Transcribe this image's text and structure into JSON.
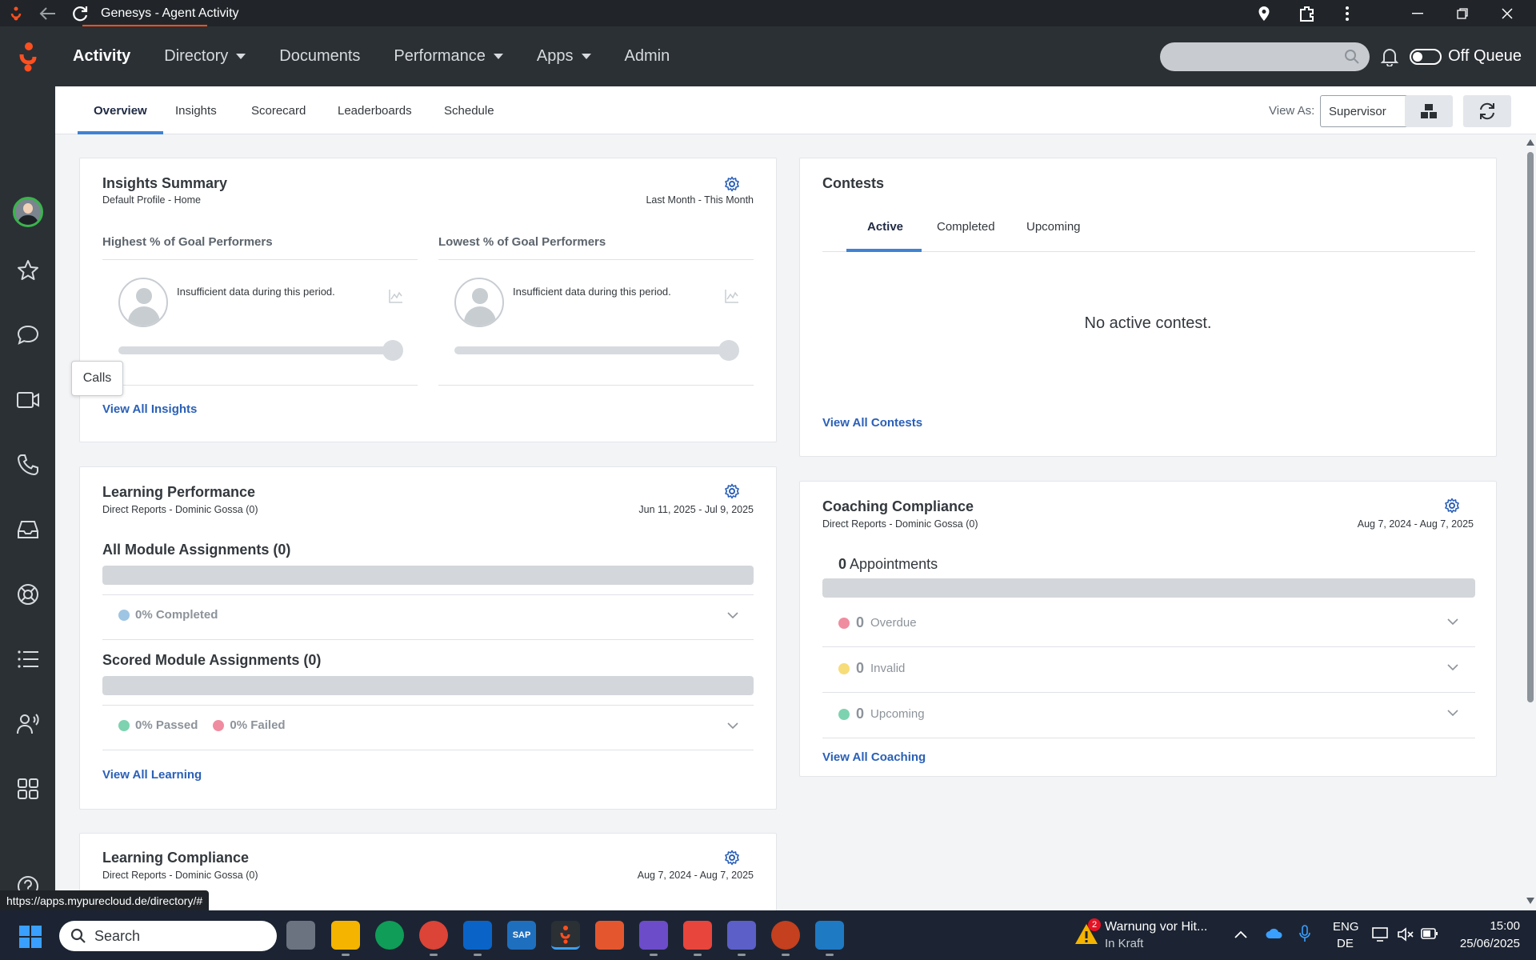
{
  "window": {
    "title": "Genesys - Agent Activity"
  },
  "topnav": {
    "items": [
      "Activity",
      "Directory",
      "Documents",
      "Performance",
      "Apps",
      "Admin"
    ],
    "queue_label": "Off Queue"
  },
  "sidebar": {
    "tooltip": "Calls"
  },
  "subtabs": {
    "items": [
      "Overview",
      "Insights",
      "Scorecard",
      "Leaderboards",
      "Schedule"
    ],
    "view_as_label": "View As:",
    "view_as_value": "Supervisor"
  },
  "insights": {
    "title": "Insights Summary",
    "subtitle": "Default Profile - Home",
    "range": "Last Month - This Month",
    "highest_title": "Highest % of Goal Performers",
    "lowest_title": "Lowest % of Goal Performers",
    "insufficient": "Insufficient data during this period.",
    "link": "View All Insights"
  },
  "learning_performance": {
    "title": "Learning Performance",
    "subtitle": "Direct Reports - Dominic Gossa (0)",
    "range": "Jun 11, 2025 - Jul 9, 2025",
    "all_modules": "All Module Assignments (0)",
    "completed": "0% Completed",
    "scored_modules": "Scored Module Assignments (0)",
    "passed": "0% Passed",
    "failed": "0% Failed",
    "link": "View All Learning"
  },
  "learning_compliance": {
    "title": "Learning Compliance",
    "subtitle": "Direct Reports - Dominic Gossa (0)",
    "range": "Aug 7, 2024 - Aug 7, 2025"
  },
  "contests": {
    "title": "Contests",
    "tabs": [
      "Active",
      "Completed",
      "Upcoming"
    ],
    "empty": "No active contest.",
    "link": "View All Contests"
  },
  "coaching": {
    "title": "Coaching Compliance",
    "subtitle": "Direct Reports - Dominic Gossa (0)",
    "range": "Aug 7, 2024 - Aug 7, 2025",
    "appointments_count": "0",
    "appointments_label": "Appointments",
    "rows": [
      {
        "count": "0",
        "label": "Overdue"
      },
      {
        "count": "0",
        "label": "Invalid"
      },
      {
        "count": "0",
        "label": "Upcoming"
      }
    ],
    "link": "View All Coaching"
  },
  "status_url": "https://apps.mypurecloud.de/directory/#",
  "taskbar": {
    "search": "Search",
    "weather_title": "Warnung vor Hit...",
    "weather_sub": "In Kraft",
    "weather_badge": "2",
    "lang_top": "ENG",
    "lang_bottom": "DE",
    "time": "15:00",
    "date": "25/06/2025",
    "sap_label": "SAP"
  },
  "colors": {
    "accent": "#3f82d4",
    "link": "#2a60b8",
    "brand": "#ff4f1f",
    "completed_dot": "#9ec5e3",
    "passed_dot": "#7dd3b0",
    "failed_dot": "#f08ca0",
    "overdue_dot": "#f08ca0",
    "invalid_dot": "#f7dc7a",
    "upcoming_dot": "#7dd3b0"
  }
}
